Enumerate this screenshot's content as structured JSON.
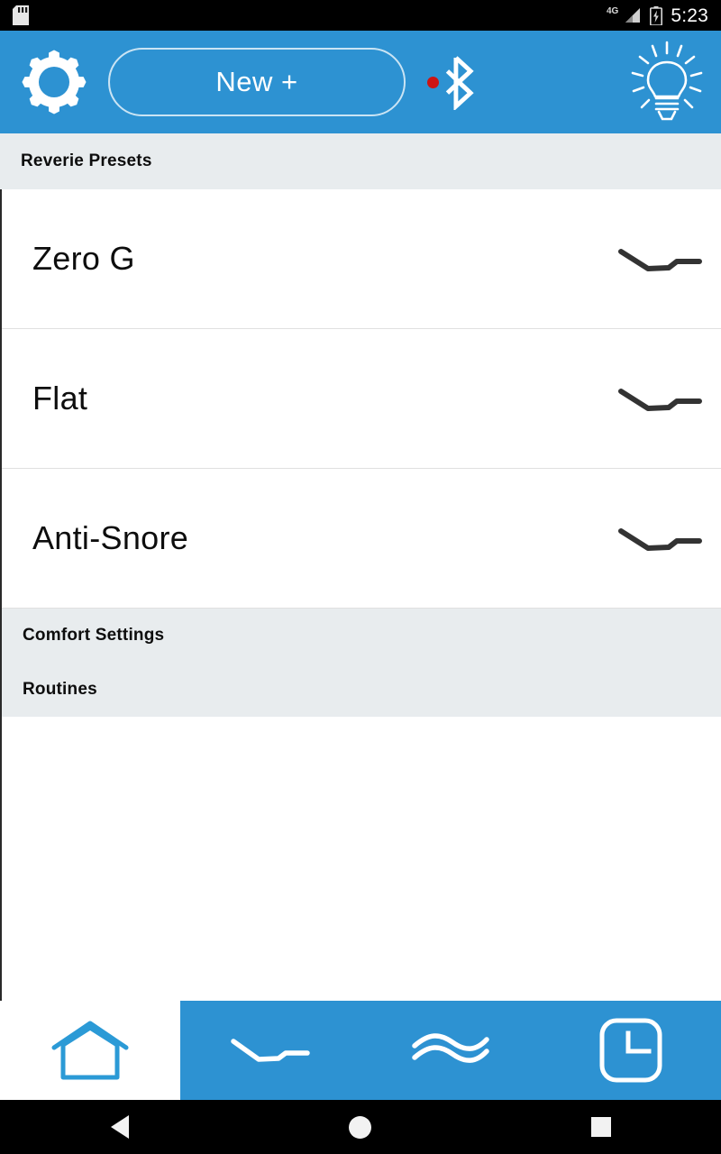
{
  "statusbar": {
    "sd_icon": "sd-card-icon",
    "network": "4G",
    "signal_icon": "signal-bars-icon",
    "battery_icon": "battery-charging-icon",
    "time": "5:23"
  },
  "appbar": {
    "settings_icon": "gear-icon",
    "new_button_label": "New +",
    "bluetooth_icon": "bluetooth-icon",
    "bluetooth_status_dot_color": "#cc1414",
    "lightbulb_icon": "lightbulb-icon",
    "background_color": "#2d92d2"
  },
  "sections": {
    "presets_header": "Reverie Presets",
    "settings_header_color": "#e8ecee"
  },
  "presets": [
    {
      "label": "Zero G",
      "icon": "bed-position-curve-icon"
    },
    {
      "label": "Flat",
      "icon": "bed-position-curve-icon"
    },
    {
      "label": "Anti-Snore",
      "icon": "bed-position-curve-icon"
    }
  ],
  "settings_group": [
    {
      "label": "Comfort Settings"
    },
    {
      "label": "Routines"
    }
  ],
  "tabbar": [
    {
      "name": "home",
      "icon": "home-icon",
      "active": false,
      "accent": "#2d92d2"
    },
    {
      "name": "position",
      "icon": "bed-position-curve-icon",
      "active": true,
      "accent": "#ffffff"
    },
    {
      "name": "massage",
      "icon": "wave-icon",
      "active": true,
      "accent": "#ffffff"
    },
    {
      "name": "timer",
      "icon": "clock-icon",
      "active": true,
      "accent": "#ffffff"
    }
  ],
  "navbar": {
    "back": "back-triangle-icon",
    "home": "home-circle-icon",
    "recents": "recents-square-icon"
  }
}
